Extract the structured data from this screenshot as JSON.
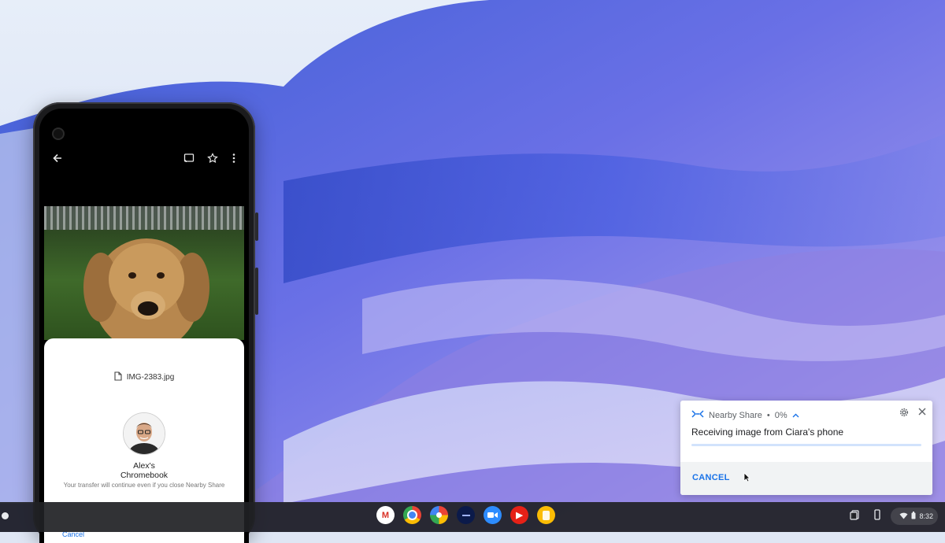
{
  "phone": {
    "file_name": "IMG-2383.jpg",
    "device_name_line1": "Alex's",
    "device_name_line2": "Chromebook",
    "note": "Your transfer will continue even if you close Nearby Share",
    "cancel_label": "Cancel",
    "icons": {
      "back": "arrow-back-icon",
      "cast": "cast-icon",
      "favorite": "star-icon",
      "menu": "more-vert-icon",
      "file": "file-icon"
    }
  },
  "notification": {
    "app_name": "Nearby Share",
    "separator": "•",
    "percent_label": "0%",
    "progress_percent": 0,
    "message": "Receiving image from Ciara's phone",
    "cancel_label": "CANCEL",
    "icons": {
      "app": "nearby-share-icon",
      "expand": "chevron-up-icon",
      "settings": "gear-icon",
      "close": "close-icon"
    }
  },
  "shelf": {
    "apps": [
      {
        "name": "gmail-icon",
        "glyph": "M",
        "color": "#ffffff",
        "fg": "#d93025"
      },
      {
        "name": "chrome-icon",
        "glyph": "",
        "color": "#ffffff",
        "fg": "#ffffff"
      },
      {
        "name": "google-photos-icon",
        "glyph": "",
        "color": "#ffffff",
        "fg": "#ffffff"
      },
      {
        "name": "app-icon",
        "glyph": "",
        "color": "#0b1a4a",
        "fg": "#ffffff"
      },
      {
        "name": "zoom-icon",
        "glyph": "",
        "color": "#2d8cff",
        "fg": "#ffffff"
      },
      {
        "name": "youtube-icon",
        "glyph": "▶",
        "color": "#e62117",
        "fg": "#ffffff"
      },
      {
        "name": "google-keep-icon",
        "glyph": "",
        "color": "#fbbc04",
        "fg": "#ffffff"
      }
    ],
    "clock": "8:32",
    "icons": {
      "launcher": "launcher-icon",
      "clipboard": "clipboard-icon",
      "phone_hub": "phone-hub-icon",
      "wifi": "wifi-icon",
      "battery": "battery-icon"
    }
  },
  "colors": {
    "accent": "#1a73e8",
    "shelf": "#202124"
  }
}
